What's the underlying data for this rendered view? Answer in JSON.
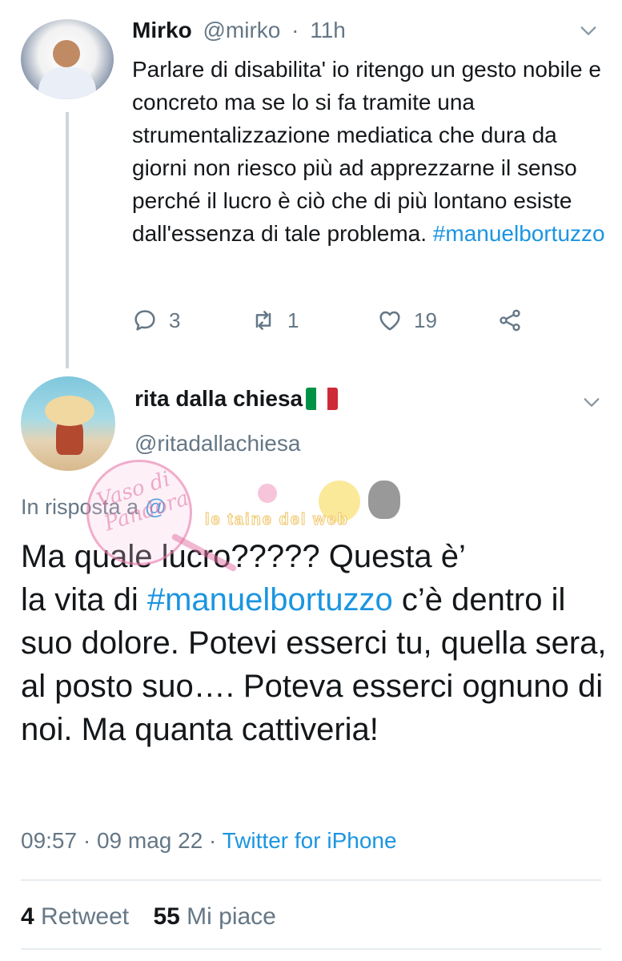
{
  "reply_tweet": {
    "author_name": "Mirko",
    "handle": "@mirko",
    "time": "11h",
    "text_before": "Parlare di disabilita' io ritengo un gesto nobile e concreto ma se lo si fa tramite una strumentalizzazione mediatica che dura da giorni non riesco più ad apprezzarne il senso perché il lucro è ciò che di più lontano esiste dall'essenza di tale problema. ",
    "hashtag": "#manuelbortuzzo",
    "replies": "3",
    "retweets": "1",
    "likes": "19"
  },
  "main_tweet": {
    "author_name": "rita dalla chiesa",
    "handle": "@ritadallachiesa",
    "reply_to_label": "In risposta a",
    "reply_to_handle": "@",
    "text_line1": "Ma quale lucro????? Questa è’",
    "text_line2_prefix": "la vita di ",
    "hashtag": "#manuelbortuzzo",
    "text_rest": " c’è dentro il suo dolore. Potevi esserci tu, quella sera, al posto suo…. Poteva esserci ognuno di noi. Ma quanta cattiveria!",
    "timestamp": "09:57 · 09 mag 22 · ",
    "source": "Twitter for iPhone",
    "retweet_count": "4",
    "retweet_label": "Retweet",
    "like_count": "55",
    "like_label": "Mi piace"
  },
  "watermark": {
    "script_text": "Vaso di Pandora",
    "banner_text": "le taine del web"
  },
  "colors": {
    "link": "#1b95e0",
    "muted": "#657786",
    "text": "#14171a",
    "divider": "#e6ecf0"
  }
}
